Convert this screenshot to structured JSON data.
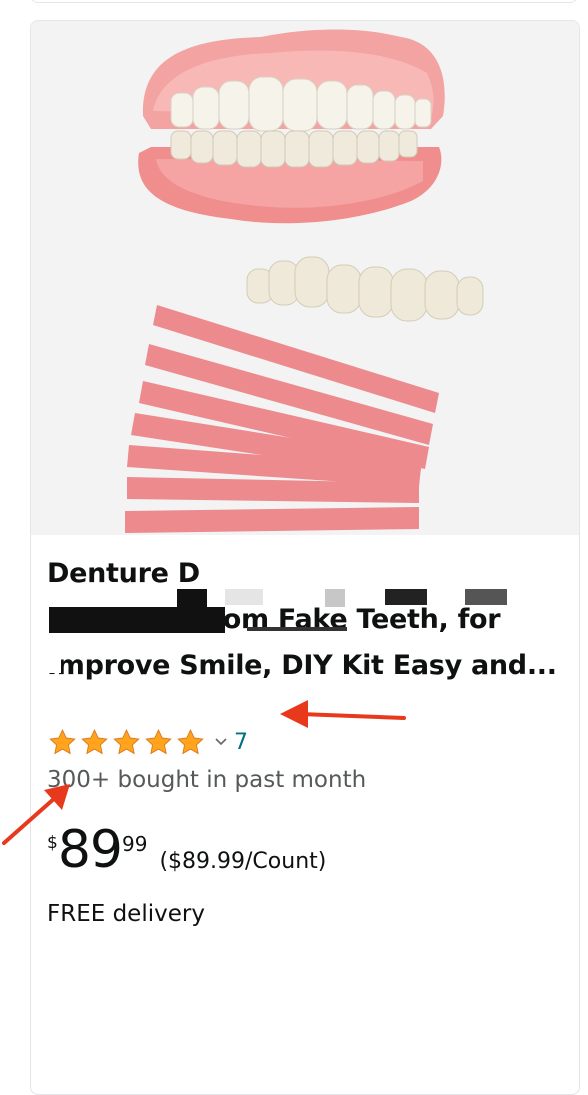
{
  "product": {
    "title_lines": [
      "Denture D",
      " Bottom Fake Teeth, for",
      "Improve Smile, DIY Kit Easy and..."
    ],
    "rating": {
      "stars": 5,
      "review_count": "7"
    },
    "bought_text": "300+ bought in past month",
    "price": {
      "symbol": "$",
      "whole": "89",
      "fraction": "99",
      "unit_price": "($89.99/Count)"
    },
    "delivery": "FREE delivery"
  },
  "colors": {
    "star": "#ffa41c",
    "review_link": "#007185",
    "annotation_arrow": "#e8391d",
    "card_border": "#e3e6e6"
  },
  "icons": [
    "star-icon",
    "chevron-down-icon",
    "red-arrow-annotation"
  ]
}
